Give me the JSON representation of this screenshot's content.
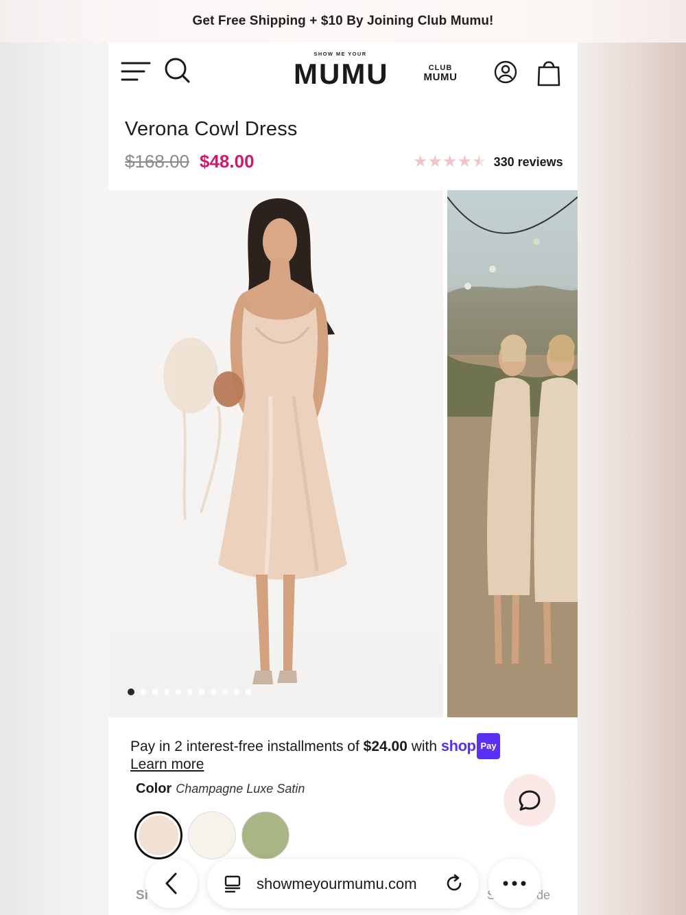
{
  "promo": {
    "text": "Get Free Shipping + $10 By Joining Club Mumu!"
  },
  "header": {
    "logo_small": "SHOW ME YOUR",
    "logo_big": "MUMU",
    "club_small": "CLUB",
    "club_big": "MUMU"
  },
  "product": {
    "title": "Verona Cowl Dress",
    "price_old": "$168.00",
    "price_new": "$48.00",
    "rating": 4.5,
    "reviews": "330 reviews",
    "image_count": 11,
    "active_image": 1
  },
  "payment": {
    "text_before": "Pay in 2 interest-free installments of ",
    "amount": "$24.00",
    "text_after": " with ",
    "shop": "shop",
    "pay_badge": "Pay",
    "learn_more": "Learn more"
  },
  "color": {
    "label": "Color",
    "selected": "Champagne Luxe Satin",
    "swatches": [
      "#f1e0d4",
      "#f6f3ea",
      "#a9b584"
    ]
  },
  "peek": {
    "size": "Si",
    "guide_left": "S",
    "guide_right": "de"
  },
  "browser": {
    "url": "showmeyourmumu.com"
  },
  "colors": {
    "sale": "#d1196c",
    "shop_pay": "#5a31f4",
    "star": "#f2c4c8"
  }
}
